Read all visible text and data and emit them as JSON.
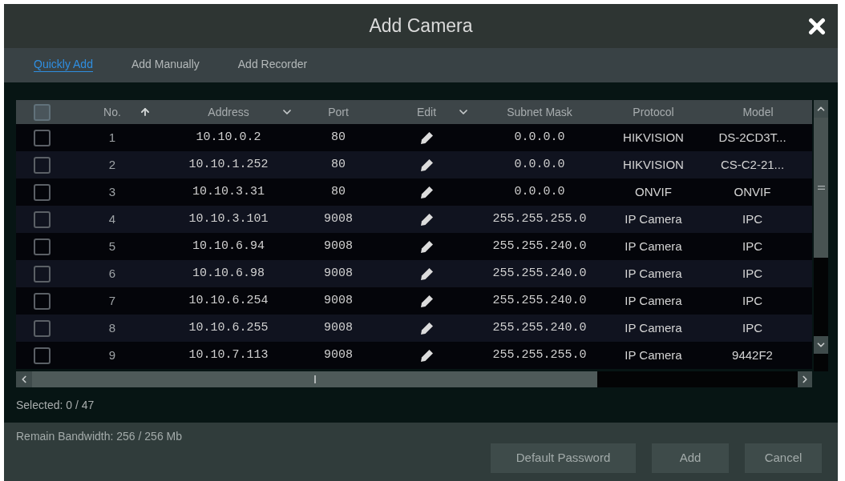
{
  "dialog": {
    "title": "Add Camera"
  },
  "tabs": [
    {
      "label": "Quickly Add",
      "selected": true
    },
    {
      "label": "Add Manually",
      "selected": false
    },
    {
      "label": "Add Recorder",
      "selected": false
    }
  ],
  "table": {
    "select_all": {
      "checked": false
    },
    "columns": [
      {
        "label": "No.",
        "kind": "sort"
      },
      {
        "label": "Address",
        "kind": "menu"
      },
      {
        "label": "Port",
        "kind": "plain"
      },
      {
        "label": "Edit",
        "kind": "menu"
      },
      {
        "label": "Subnet Mask",
        "kind": "plain"
      },
      {
        "label": "Protocol",
        "kind": "plain"
      },
      {
        "label": "Model",
        "kind": "plain"
      }
    ],
    "rows": [
      {
        "checked": false,
        "no": "1",
        "address": "10.10.0.2",
        "port": "80",
        "subnet_mask": "0.0.0.0",
        "protocol": "HIKVISION",
        "model": "DS-2CD3T..."
      },
      {
        "checked": false,
        "no": "2",
        "address": "10.10.1.252",
        "port": "80",
        "subnet_mask": "0.0.0.0",
        "protocol": "HIKVISION",
        "model": "CS-C2-21..."
      },
      {
        "checked": false,
        "no": "3",
        "address": "10.10.3.31",
        "port": "80",
        "subnet_mask": "0.0.0.0",
        "protocol": "ONVIF",
        "model": "ONVIF"
      },
      {
        "checked": false,
        "no": "4",
        "address": "10.10.3.101",
        "port": "9008",
        "subnet_mask": "255.255.255.0",
        "protocol": "IP Camera",
        "model": "IPC"
      },
      {
        "checked": false,
        "no": "5",
        "address": "10.10.6.94",
        "port": "9008",
        "subnet_mask": "255.255.240.0",
        "protocol": "IP Camera",
        "model": "IPC"
      },
      {
        "checked": false,
        "no": "6",
        "address": "10.10.6.98",
        "port": "9008",
        "subnet_mask": "255.255.240.0",
        "protocol": "IP Camera",
        "model": "IPC"
      },
      {
        "checked": false,
        "no": "7",
        "address": "10.10.6.254",
        "port": "9008",
        "subnet_mask": "255.255.240.0",
        "protocol": "IP Camera",
        "model": "IPC"
      },
      {
        "checked": false,
        "no": "8",
        "address": "10.10.6.255",
        "port": "9008",
        "subnet_mask": "255.255.240.0",
        "protocol": "IP Camera",
        "model": "IPC"
      },
      {
        "checked": false,
        "no": "9",
        "address": "10.10.7.113",
        "port": "9008",
        "subnet_mask": "255.255.255.0",
        "protocol": "IP Camera",
        "model": "9442F2"
      }
    ]
  },
  "selected_count": "Selected: 0 / 47",
  "bandwidth": "Remain Bandwidth: 256 / 256 Mb",
  "buttons": [
    "Default Password",
    "Add",
    "Cancel"
  ]
}
